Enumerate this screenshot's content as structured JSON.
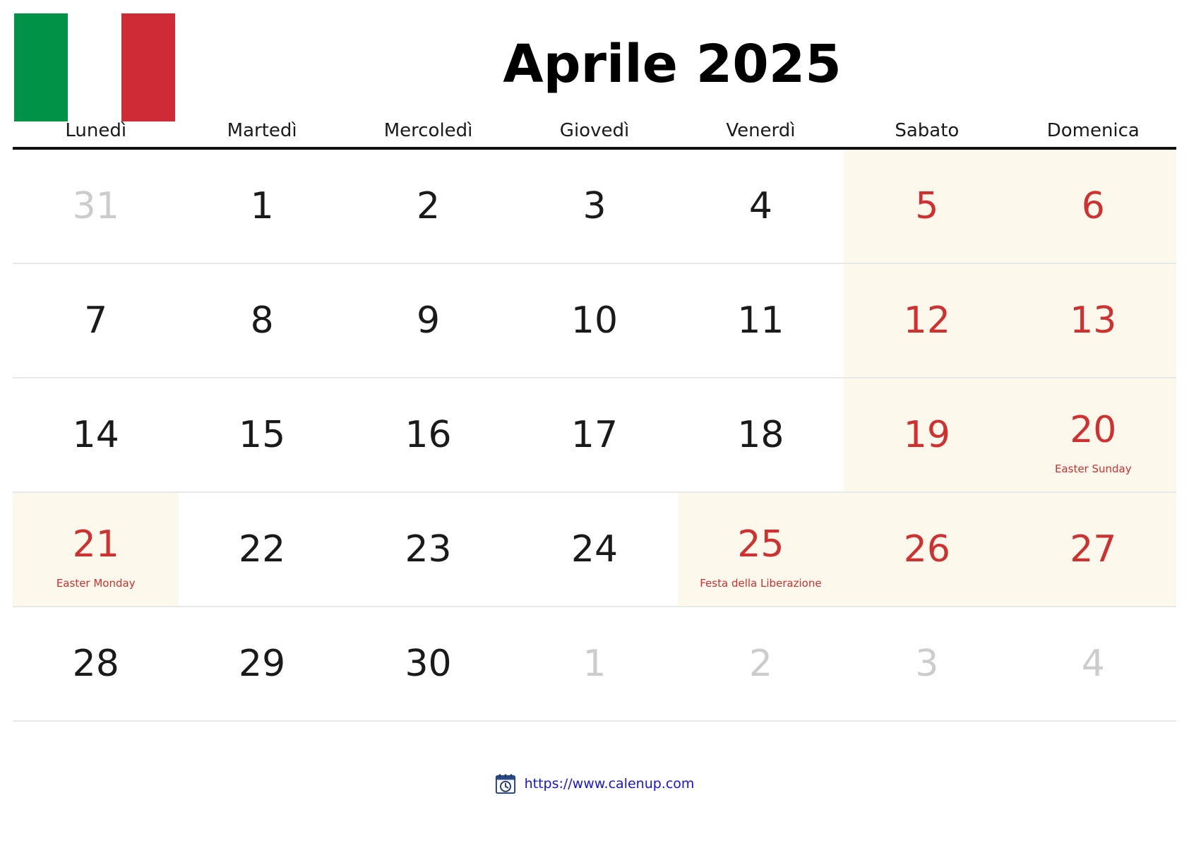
{
  "header": {
    "title": "Aprile 2025",
    "flag": {
      "name": "italy-flag",
      "bands": [
        "#009246",
        "#ffffff",
        "#ce2b37"
      ]
    }
  },
  "weekdays": [
    "Lunedì",
    "Martedì",
    "Mercoledì",
    "Giovedì",
    "Venerdì",
    "Sabato",
    "Domenica"
  ],
  "colors": {
    "holiday_red": "#cf3030",
    "weekend_bg": "#fdf8ec",
    "muted_day": "#cccccc",
    "grid_line": "#e8e8e8",
    "header_rule": "#111111",
    "link_blue": "#1515dd"
  },
  "weeks": [
    [
      {
        "day": "31",
        "muted": true,
        "red": false,
        "weekend": false,
        "label": ""
      },
      {
        "day": "1",
        "muted": false,
        "red": false,
        "weekend": false,
        "label": ""
      },
      {
        "day": "2",
        "muted": false,
        "red": false,
        "weekend": false,
        "label": ""
      },
      {
        "day": "3",
        "muted": false,
        "red": false,
        "weekend": false,
        "label": ""
      },
      {
        "day": "4",
        "muted": false,
        "red": false,
        "weekend": false,
        "label": ""
      },
      {
        "day": "5",
        "muted": false,
        "red": true,
        "weekend": true,
        "label": ""
      },
      {
        "day": "6",
        "muted": false,
        "red": true,
        "weekend": true,
        "label": ""
      }
    ],
    [
      {
        "day": "7",
        "muted": false,
        "red": false,
        "weekend": false,
        "label": ""
      },
      {
        "day": "8",
        "muted": false,
        "red": false,
        "weekend": false,
        "label": ""
      },
      {
        "day": "9",
        "muted": false,
        "red": false,
        "weekend": false,
        "label": ""
      },
      {
        "day": "10",
        "muted": false,
        "red": false,
        "weekend": false,
        "label": ""
      },
      {
        "day": "11",
        "muted": false,
        "red": false,
        "weekend": false,
        "label": ""
      },
      {
        "day": "12",
        "muted": false,
        "red": true,
        "weekend": true,
        "label": ""
      },
      {
        "day": "13",
        "muted": false,
        "red": true,
        "weekend": true,
        "label": ""
      }
    ],
    [
      {
        "day": "14",
        "muted": false,
        "red": false,
        "weekend": false,
        "label": ""
      },
      {
        "day": "15",
        "muted": false,
        "red": false,
        "weekend": false,
        "label": ""
      },
      {
        "day": "16",
        "muted": false,
        "red": false,
        "weekend": false,
        "label": ""
      },
      {
        "day": "17",
        "muted": false,
        "red": false,
        "weekend": false,
        "label": ""
      },
      {
        "day": "18",
        "muted": false,
        "red": false,
        "weekend": false,
        "label": ""
      },
      {
        "day": "19",
        "muted": false,
        "red": true,
        "weekend": true,
        "label": ""
      },
      {
        "day": "20",
        "muted": false,
        "red": true,
        "weekend": true,
        "label": "Easter Sunday"
      }
    ],
    [
      {
        "day": "21",
        "muted": false,
        "red": true,
        "weekend": true,
        "label": "Easter Monday"
      },
      {
        "day": "22",
        "muted": false,
        "red": false,
        "weekend": false,
        "label": ""
      },
      {
        "day": "23",
        "muted": false,
        "red": false,
        "weekend": false,
        "label": ""
      },
      {
        "day": "24",
        "muted": false,
        "red": false,
        "weekend": false,
        "label": ""
      },
      {
        "day": "25",
        "muted": false,
        "red": true,
        "weekend": true,
        "label": "Festa della Liberazione"
      },
      {
        "day": "26",
        "muted": false,
        "red": true,
        "weekend": true,
        "label": ""
      },
      {
        "day": "27",
        "muted": false,
        "red": true,
        "weekend": true,
        "label": ""
      }
    ],
    [
      {
        "day": "28",
        "muted": false,
        "red": false,
        "weekend": false,
        "label": ""
      },
      {
        "day": "29",
        "muted": false,
        "red": false,
        "weekend": false,
        "label": ""
      },
      {
        "day": "30",
        "muted": false,
        "red": false,
        "weekend": false,
        "label": ""
      },
      {
        "day": "1",
        "muted": true,
        "red": false,
        "weekend": false,
        "label": ""
      },
      {
        "day": "2",
        "muted": true,
        "red": false,
        "weekend": false,
        "label": ""
      },
      {
        "day": "3",
        "muted": true,
        "red": false,
        "weekend": false,
        "label": ""
      },
      {
        "day": "4",
        "muted": true,
        "red": false,
        "weekend": false,
        "label": ""
      }
    ]
  ],
  "footer": {
    "icon": "calendar-clock-icon",
    "url": "https://www.calenup.com"
  }
}
